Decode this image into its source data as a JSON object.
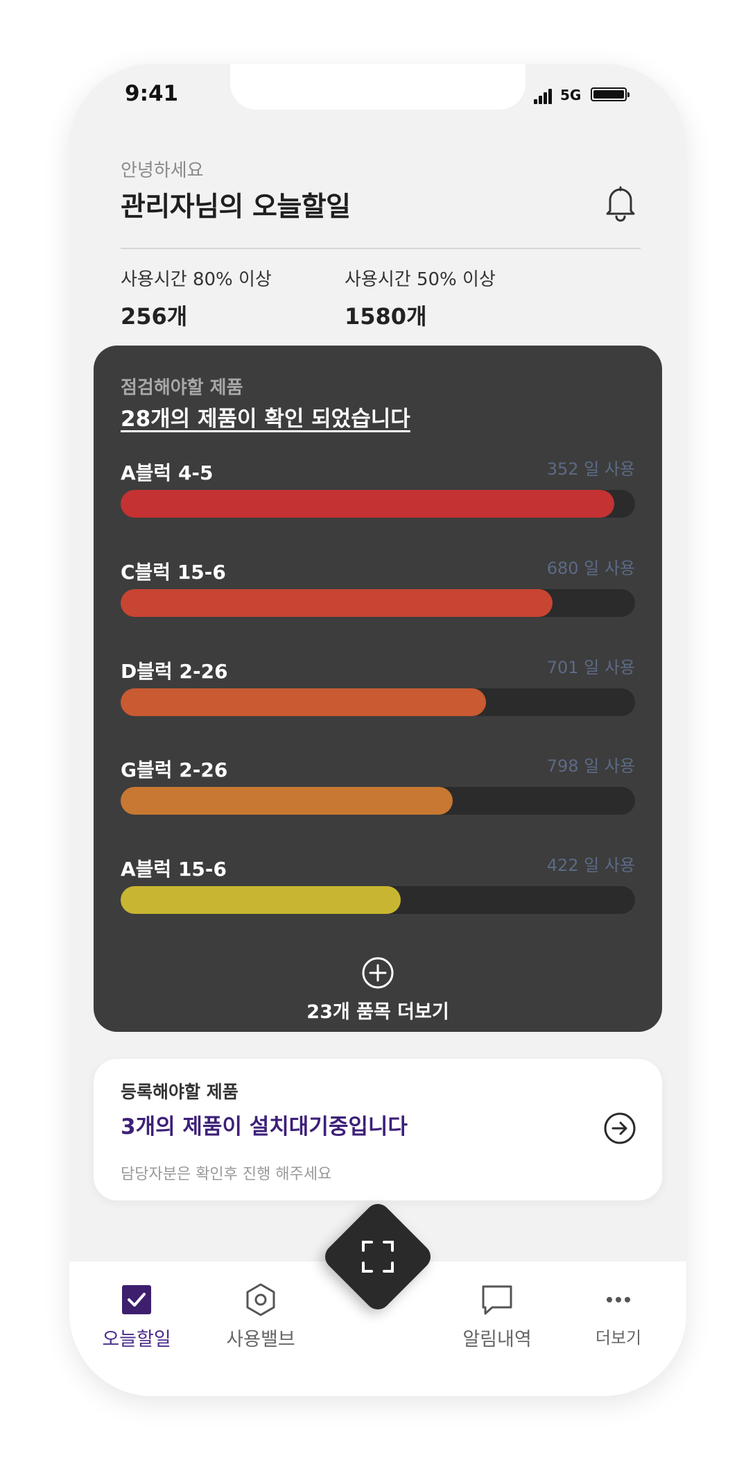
{
  "status_bar": {
    "time": "9:41",
    "network": "5G"
  },
  "header": {
    "greeting": "안녕하세요",
    "title": "관리자님의 오늘할일"
  },
  "stats": [
    {
      "label": "사용시간 80% 이상",
      "value": "256개"
    },
    {
      "label": "사용시간 50% 이상",
      "value": "1580개"
    }
  ],
  "inspect_card": {
    "label": "점검해야할 제품",
    "headline": "28개의 제품이 확인 되었습니다",
    "items": [
      {
        "name": "A블럭 4-5",
        "days": "352 일 사용",
        "progress": 0.96,
        "color": "#c53233"
      },
      {
        "name": "C블럭 15-6",
        "days": "680 일 사용",
        "progress": 0.84,
        "color": "#c84532"
      },
      {
        "name": "D블럭 2-26",
        "days": "701 일 사용",
        "progress": 0.71,
        "color": "#c95a32"
      },
      {
        "name": "G블럭 2-26",
        "days": "798 일 사용",
        "progress": 0.645,
        "color": "#c87832"
      },
      {
        "name": "A블럭 15-6",
        "days": "422 일 사용",
        "progress": 0.545,
        "color": "#c8b632"
      }
    ],
    "more_label": "23개 품목 더보기"
  },
  "register_card": {
    "label": "등록해야할 제품",
    "headline": "3개의 제품이 설치대기중입니다",
    "subtext": "담당자분은 확인후 진행 해주세요"
  },
  "tabbar": {
    "tabs": [
      {
        "label": "오늘할일",
        "icon": "checkbox-icon",
        "active": true
      },
      {
        "label": "사용밸브",
        "icon": "hexagon-icon",
        "active": false
      },
      {
        "label": "알림내역",
        "icon": "chat-icon",
        "active": false
      },
      {
        "label": "더보기",
        "icon": "more-dots-icon",
        "active": false
      }
    ],
    "fab_icon": "scan-icon"
  },
  "colors": {
    "accent": "#4a2c8a",
    "card_dark": "#3d3d3d",
    "background": "#f2f2f2"
  }
}
